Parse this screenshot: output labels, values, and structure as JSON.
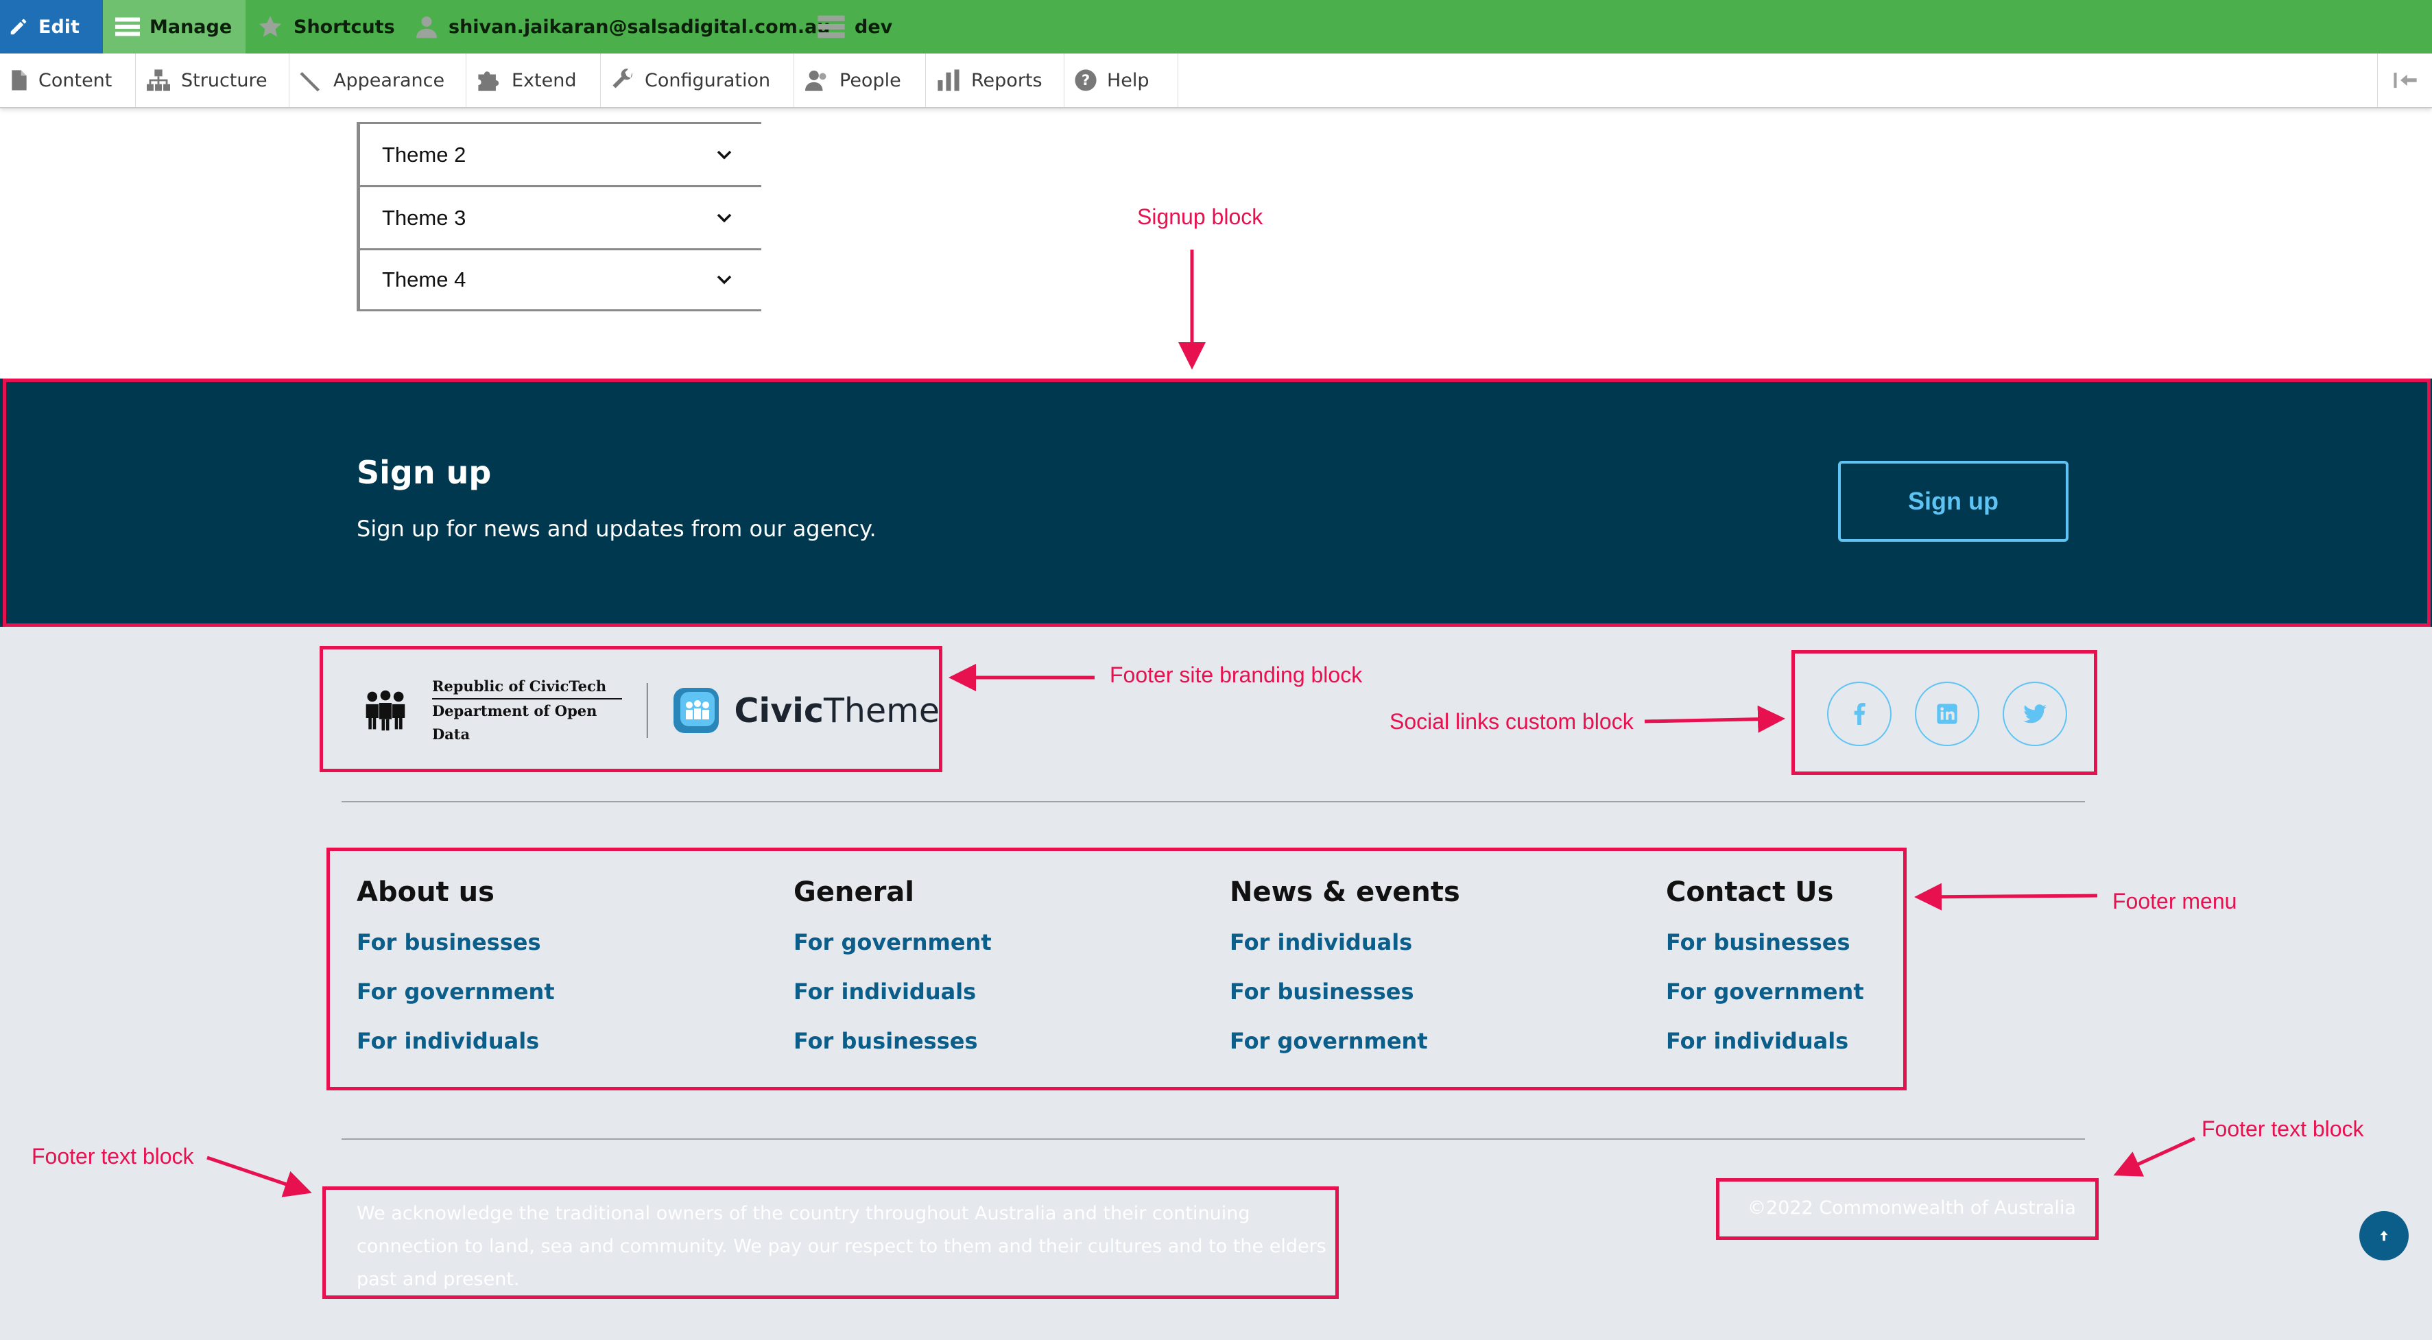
{
  "toolbar": {
    "edit_label": "Edit",
    "manage_label": "Manage",
    "shortcuts_label": "Shortcuts",
    "user_email": "shivan.jaikaran@salsadigital.com.au",
    "env_label": "dev"
  },
  "tray": {
    "items": [
      {
        "label": "Content",
        "icon": "document-icon"
      },
      {
        "label": "Structure",
        "icon": "structure-icon"
      },
      {
        "label": "Appearance",
        "icon": "brush-icon"
      },
      {
        "label": "Extend",
        "icon": "puzzle-icon"
      },
      {
        "label": "Configuration",
        "icon": "wrench-icon"
      },
      {
        "label": "People",
        "icon": "people-icon"
      },
      {
        "label": "Reports",
        "icon": "bar-chart-icon"
      },
      {
        "label": "Help",
        "icon": "help-icon"
      }
    ]
  },
  "accordion": {
    "items": [
      "Theme 2",
      "Theme 3",
      "Theme 4"
    ]
  },
  "annotations": {
    "signup_block": "Signup block",
    "branding_block": "Footer site branding block",
    "social_block": "Social links custom block",
    "footer_menu": "Footer menu",
    "footer_text_left": "Footer text block",
    "footer_text_right": "Footer text block",
    "color": "#e8114f"
  },
  "signup": {
    "title": "Sign up",
    "text": "Sign up for news and updates from our agency.",
    "button": "Sign up"
  },
  "branding": {
    "org_line1": "Republic of CivicTech",
    "org_line2": "Department of Open Data",
    "brand_bold": "Civic",
    "brand_light": "Theme"
  },
  "social": [
    "facebook-icon",
    "linkedin-icon",
    "twitter-icon"
  ],
  "footer_menu": [
    {
      "title": "About us",
      "links": [
        "For businesses",
        "For government",
        "For individuals"
      ]
    },
    {
      "title": "General",
      "links": [
        "For government",
        "For individuals",
        "For businesses"
      ]
    },
    {
      "title": "News & events",
      "links": [
        "For individuals",
        "For businesses",
        "For government"
      ]
    },
    {
      "title": "Contact Us",
      "links": [
        "For businesses",
        "For government",
        "For individuals"
      ]
    }
  ],
  "footer_text": {
    "acknowledgement": "We acknowledge the traditional owners of the country throughout Australia and their continuing connection to land, sea and community. We pay our respect to them and their cultures and to the elders past and present.",
    "copyright": "©2022 Commonwealth of Australia"
  },
  "colors": {
    "toolbar_green": "#4bb04c",
    "edit_blue": "#1f6fb6",
    "signup_bg": "#00394f",
    "footer_bg": "#e5e8ed",
    "link": "#0b5e8a",
    "accent": "#5fc3f3"
  }
}
